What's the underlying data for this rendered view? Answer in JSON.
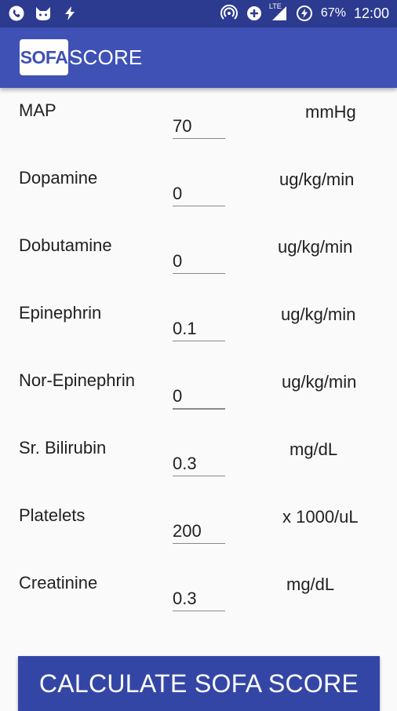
{
  "status_bar": {
    "battery_percent": "67%",
    "time": "12:00",
    "network": "LTE",
    "icons_left": [
      "phone-icon",
      "cat-icon",
      "lightning-icon"
    ],
    "icons_right": [
      "hotspot-icon",
      "data-saver-icon",
      "signal-icon",
      "battery-icon"
    ]
  },
  "app_bar": {
    "logo_box_text": "SOFA",
    "logo_rest_text": "SCORE",
    "primary_color": "#3f51b5",
    "status_color": "#2c3b90"
  },
  "fields": [
    {
      "label": "MAP",
      "value": "70",
      "unit": "mmHg"
    },
    {
      "label": "Dopamine",
      "value": "0",
      "unit": "ug/kg/min"
    },
    {
      "label": "Dobutamine",
      "value": "0",
      "unit": "ug/kg/min"
    },
    {
      "label": "Epinephrin",
      "value": "0.1",
      "unit": "ug/kg/min"
    },
    {
      "label": "Nor-Epinephrin",
      "value": "0",
      "unit": "ug/kg/min"
    },
    {
      "label": "Sr. Bilirubin",
      "value": "0.3",
      "unit": "mg/dL"
    },
    {
      "label": "Platelets",
      "value": "200",
      "unit": "x 1000/uL"
    },
    {
      "label": "Creatinine",
      "value": "0.3",
      "unit": "mg/dL"
    }
  ],
  "calculate_button": {
    "label": "CALCULATE SOFA SCORE",
    "color": "#3446a5"
  }
}
